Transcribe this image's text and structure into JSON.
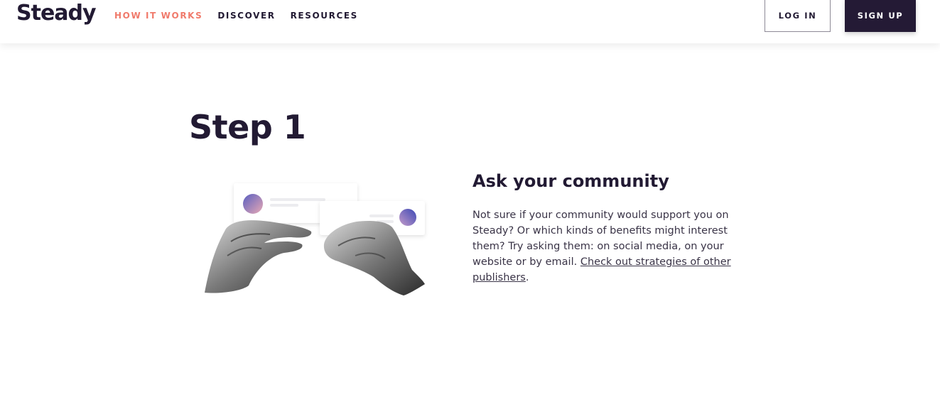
{
  "header": {
    "logo": "Steady",
    "nav": [
      {
        "label": "HOW IT WORKS",
        "active": true
      },
      {
        "label": "DISCOVER",
        "active": false
      },
      {
        "label": "RESOURCES",
        "active": false
      }
    ],
    "login_label": "LOG IN",
    "signup_label": "SIGN UP"
  },
  "main": {
    "step_title": "Step 1",
    "section_title": "Ask your community",
    "body_text": "Not sure if your community would support you on Steady? Or which kinds of benefits might interest them? Try asking them: on social media, on your website or by email.",
    "link_text": "Check out strategies of other publishers",
    "trailing": "."
  },
  "colors": {
    "brand_dark": "#221a33",
    "accent": "#f07a6b",
    "signup_bg": "#241a35"
  }
}
